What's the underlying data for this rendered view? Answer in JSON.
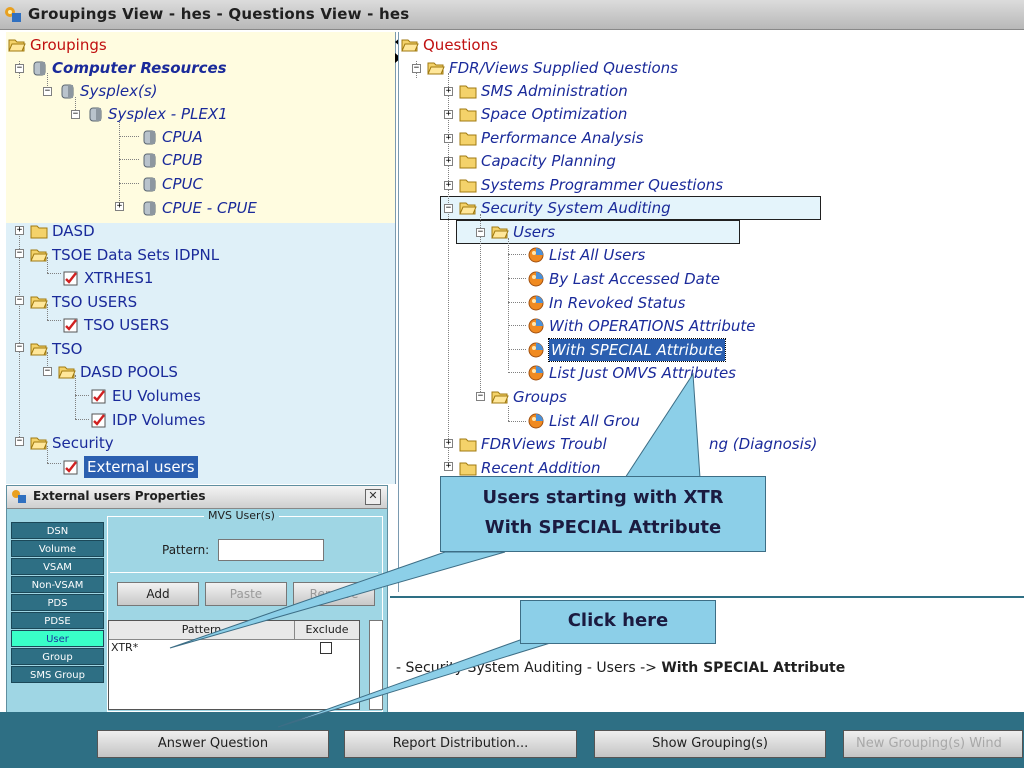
{
  "window": {
    "title": "Groupings View - hes  -  Questions View - hes"
  },
  "left_tree": {
    "root": "Groupings",
    "computer_resources": "Computer Resources",
    "sysplexes": "Sysplex(s)",
    "plex": "Sysplex - PLEX1",
    "cpus": [
      "CPUA",
      "CPUB",
      "CPUC",
      "CPUE - CPUE"
    ],
    "dasd": "DASD",
    "tsoe": "TSOE Data Sets IDPNL",
    "xtrhes": "XTRHES1",
    "tso_users_group": "TSO USERS",
    "tso_users_item": "TSO USERS",
    "tso": "TSO",
    "dasd_pools": "DASD POOLS",
    "eu_volumes": "EU Volumes",
    "idp_volumes": "IDP Volumes",
    "security": "Security",
    "external_users": "External users"
  },
  "right_tree": {
    "root": "Questions",
    "supplied": "FDR/Views Supplied Questions",
    "categories": [
      "SMS Administration",
      "Space Optimization",
      "Performance Analysis",
      "Capacity Planning",
      "Systems Programmer Questions"
    ],
    "security_auditing": "Security System Auditing",
    "users": "Users",
    "user_questions": [
      "List All Users",
      "By Last Accessed Date",
      "In Revoked Status",
      "With OPERATIONS Attribute",
      "With SPECIAL Attribute",
      "List Just OMVS Attributes"
    ],
    "groups": "Groups",
    "group_question": "List All Grou",
    "troubleshooting": "FDRViews Troubl",
    "troubleshooting_tail": "ng (Diagnosis)",
    "recent": "Recent Addition"
  },
  "properties": {
    "title": "External users Properties",
    "tabs": [
      "DSN",
      "Volume",
      "VSAM",
      "Non-VSAM",
      "PDS",
      "PDSE",
      "User",
      "Group",
      "SMS Group"
    ],
    "active_tab": "User",
    "group_label": "MVS User(s)",
    "pattern_label": "Pattern:",
    "pattern_value": "",
    "buttons": {
      "add": "Add",
      "paste": "Paste",
      "remove": "Remove"
    },
    "columns": [
      "Pattern",
      "Exclude"
    ],
    "rows": [
      {
        "pattern": "XTR*",
        "exclude": false
      }
    ]
  },
  "status": {
    "path_prefix": "- Security ",
    "path_middle": "System Auditing - Users -> ",
    "path_hidden_hint": "Sy",
    "selected_question": "With SPECIAL Attribute"
  },
  "buttons": {
    "answer": "Answer Question",
    "report": "Report Distribution...",
    "show": "Show Grouping(s)",
    "new": "New Grouping(s) Wind"
  },
  "callouts": {
    "users_line1": "Users starting with XTR",
    "users_line2": "With SPECIAL Attribute",
    "click": "Click here"
  }
}
